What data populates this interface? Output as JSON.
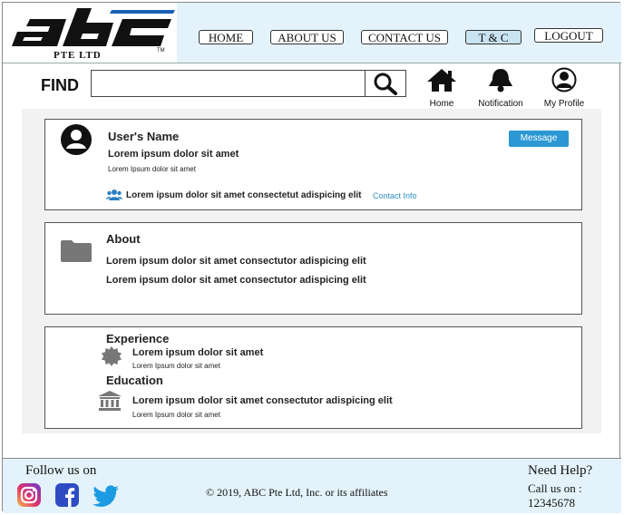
{
  "brand": {
    "logo_text": "abc",
    "company": "PTE LTD"
  },
  "nav": [
    {
      "label": "HOME",
      "active": false
    },
    {
      "label": "ABOUT US",
      "active": false
    },
    {
      "label": "CONTACT US",
      "active": false
    },
    {
      "label": "T & C",
      "active": true
    },
    {
      "label": "LOGOUT",
      "active": false
    }
  ],
  "search": {
    "label": "FIND",
    "value": "",
    "placeholder": ""
  },
  "top_icons": [
    {
      "icon": "home-icon",
      "label": "Home"
    },
    {
      "icon": "bell-icon",
      "label": "Notification"
    },
    {
      "icon": "user-circle-icon",
      "label": "My Profile"
    }
  ],
  "profile": {
    "name": "User's Name",
    "headline": "Lorem ipsum dolor sit amet",
    "subline": "Lorem Ipsum dolor sit amet",
    "connections": "Lorem ipsum dolor sit amet consectetut adispicing elit",
    "contact_link": "Contact Info",
    "message_button": "Message"
  },
  "about": {
    "title": "About",
    "lines": [
      "Lorem ipsum dolor sit amet consectutor adispicing elit",
      "Lorem ipsum dolor sit amet consectutor adispicing elit"
    ]
  },
  "experience": {
    "title": "Experience",
    "item_main": "Lorem ipsum dolor sit amet",
    "item_sub": "Lorem Ipsum dolor sit amet"
  },
  "education": {
    "title": "Education",
    "item_main": "Lorem ipsum dolor sit amet consectutor adispicing elit",
    "item_sub": "Lorem Ipsum dolor sit amet"
  },
  "footer": {
    "follow": "Follow us on",
    "copyright": "© 2019, ABC Pte Ltd, Inc. or its affiliates",
    "help": "Need Help?",
    "call": "Call us on :",
    "phone": "12345678"
  },
  "colors": {
    "accent": "#2b98d4",
    "header_bg": "#e4f3fb",
    "active_tab": "#c9e3f1"
  }
}
